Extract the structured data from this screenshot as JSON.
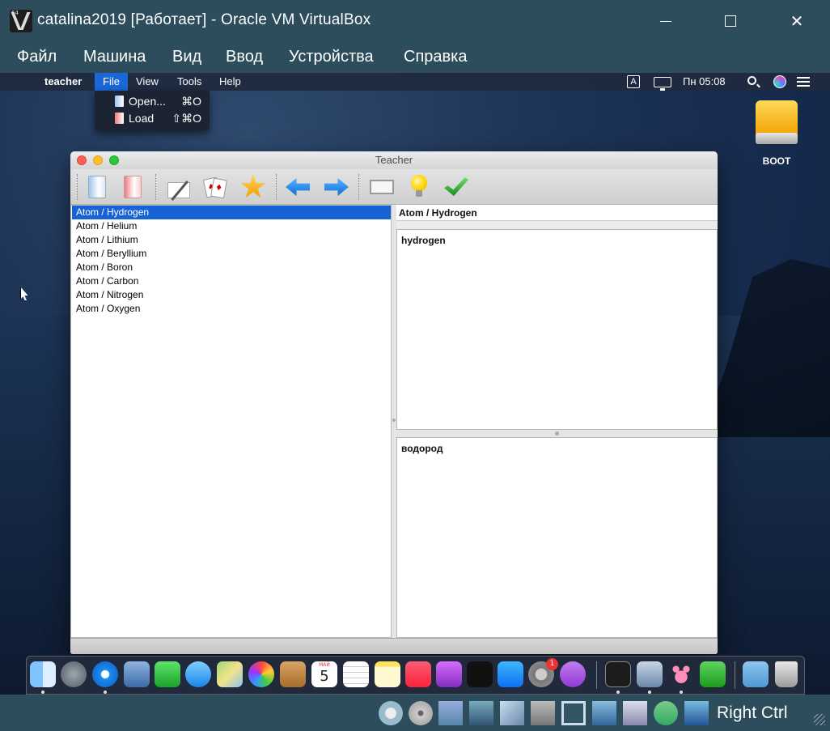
{
  "host": {
    "title": "catalina2019 [Работает] - Oracle VM VirtualBox",
    "app_badge": "64",
    "window_controls": {
      "minimize": "minimize-icon",
      "maximize": "maximize-icon",
      "close": "✕"
    },
    "menu": [
      "Файл",
      "Машина",
      "Вид",
      "Ввод",
      "Устройства",
      "Справка"
    ],
    "status_text": "Right Ctrl"
  },
  "guest": {
    "menubar": {
      "apple": "",
      "app_name": "teacher",
      "items": [
        "File",
        "View",
        "Tools",
        "Help"
      ],
      "input_source": "A",
      "clock": "Пн 05:08"
    },
    "file_menu": [
      {
        "label": "Open...",
        "shortcut": "⌘O"
      },
      {
        "label": "Load",
        "shortcut": "⇧⌘O"
      }
    ],
    "desktop_drive_label": "BOOT",
    "app": {
      "title": "Teacher",
      "toolbar_icons": [
        "open-icon",
        "load-icon",
        "edit-icon",
        "cards-icon",
        "star-icon",
        "arrow-left-icon",
        "arrow-right-icon",
        "card-rect-icon",
        "bulb-icon",
        "check-icon"
      ],
      "list": [
        "Atom / Hydrogen",
        "Atom / Helium",
        "Atom / Lithium",
        "Atom / Beryllium",
        "Atom / Boron",
        "Atom / Carbon",
        "Atom / Nitrogen",
        "Atom / Oxygen"
      ],
      "selected_index": 0,
      "detail_header": "Atom / Hydrogen",
      "front_text": "hydrogen",
      "back_text": "водород"
    },
    "dock": {
      "calendar_month": "МАЙ",
      "calendar_day": "5",
      "notification_badge": "1"
    }
  }
}
